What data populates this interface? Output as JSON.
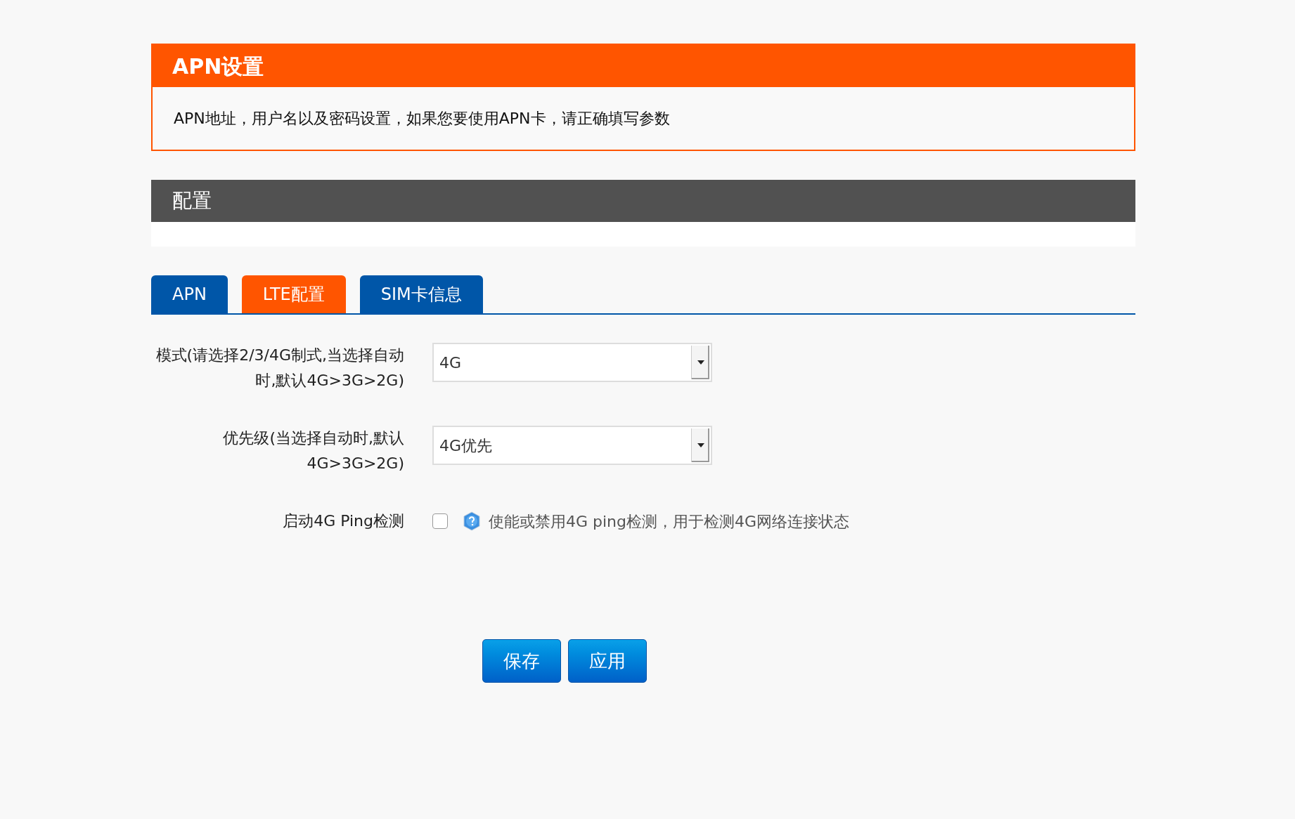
{
  "header": {
    "title": "APN设置",
    "description": "APN地址，用户名以及密码设置，如果您要使用APN卡，请正确填写参数"
  },
  "section": {
    "title": "配置"
  },
  "tabs": [
    {
      "label": "APN",
      "selected": false
    },
    {
      "label": "LTE配置",
      "selected": true
    },
    {
      "label": "SIM卡信息",
      "selected": false
    }
  ],
  "fields": [
    {
      "kind": "select",
      "label": "模式(请选择2/3/4G制式,当选择自动时,默认4G>3G>2G)",
      "value": "4G"
    },
    {
      "kind": "select",
      "label": "优先级(当选择自动时,默认4G>3G>2G)",
      "value": "4G优先"
    },
    {
      "kind": "checkbox",
      "label": "启动4G Ping检测",
      "checked": false,
      "help": "使能或禁用4G ping检测，用于检测4G网络连接状态"
    }
  ],
  "buttons": [
    "保存",
    "应用"
  ]
}
